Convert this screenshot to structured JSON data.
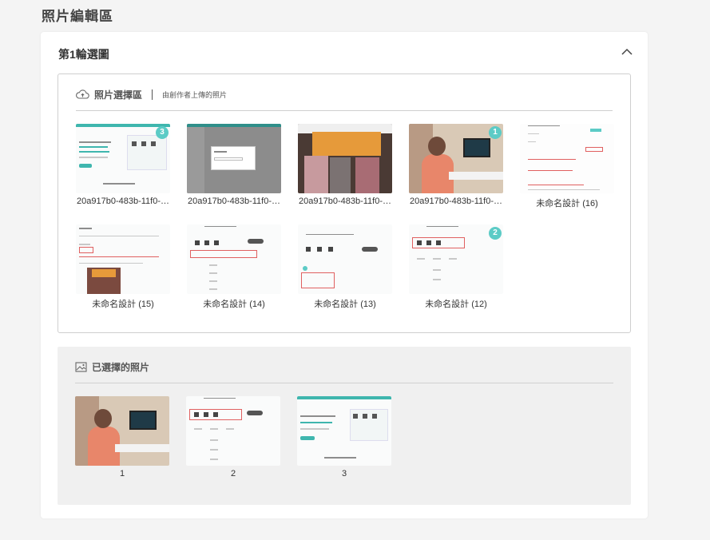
{
  "page": {
    "title": "照片編輯區"
  },
  "round": {
    "title": "第1輪選圖"
  },
  "photo_select": {
    "title": "照片選擇區",
    "subtitle": "由創作者上傳的照片",
    "photos": [
      {
        "label": "20a917b0-483b-11f0-…",
        "badge": "3"
      },
      {
        "label": "20a917b0-483b-11f0-…",
        "badge": ""
      },
      {
        "label": "20a917b0-483b-11f0-…",
        "badge": ""
      },
      {
        "label": "20a917b0-483b-11f0-…",
        "badge": "1"
      },
      {
        "label": "未命名設計 (16)",
        "badge": ""
      },
      {
        "label": "未命名設計 (15)",
        "badge": ""
      },
      {
        "label": "未命名設計 (14)",
        "badge": ""
      },
      {
        "label": "未命名設計 (13)",
        "badge": ""
      },
      {
        "label": "未命名設計 (12)",
        "badge": "2"
      }
    ]
  },
  "selected": {
    "title": "已選擇的照片",
    "items": [
      {
        "label": "1"
      },
      {
        "label": "2"
      },
      {
        "label": "3"
      }
    ]
  },
  "icons": {
    "collapse": "chevron-up-icon",
    "upload": "cloud-upload-icon",
    "image": "image-icon"
  },
  "colors": {
    "accent": "#5ccbc6",
    "panel_gray": "#f0f0f0"
  }
}
